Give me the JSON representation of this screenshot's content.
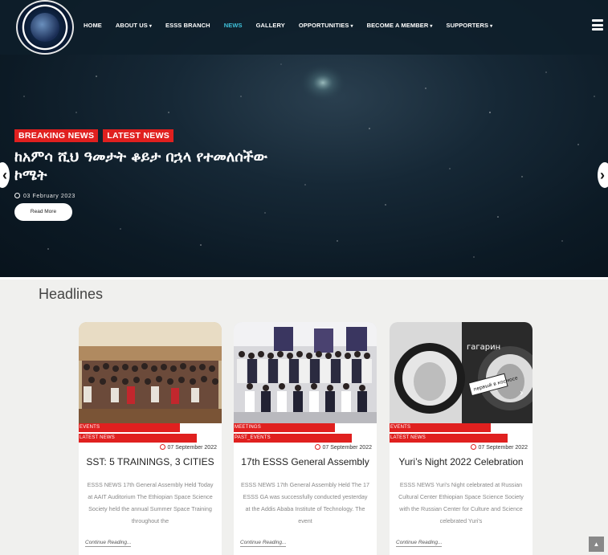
{
  "nav": {
    "items": [
      {
        "label": "HOME",
        "caret": false,
        "active": false
      },
      {
        "label": "ABOUT US",
        "caret": true,
        "active": false
      },
      {
        "label": "ESSS BRANCH",
        "caret": false,
        "active": false
      },
      {
        "label": "NEWS",
        "caret": false,
        "active": true
      },
      {
        "label": "GALLERY",
        "caret": false,
        "active": false
      },
      {
        "label": "OPPORTUNITIES",
        "caret": true,
        "active": false
      },
      {
        "label": "BECOME A MEMBER",
        "caret": true,
        "active": false
      },
      {
        "label": "SUPPORTERS",
        "caret": true,
        "active": false
      }
    ],
    "active_color": "#3fc0d9"
  },
  "hero": {
    "tags": [
      "BREAKING NEWS",
      "LATEST NEWS"
    ],
    "title": "ከአምሳ ሺህ ዓመታት ቆይታ በኋላ የተመለሰችው ኮሜት",
    "date": "03 February 2023",
    "read_more": "Read More"
  },
  "headlines": {
    "title": "Headlines",
    "cards": [
      {
        "labels": [
          "EVENTS",
          "LATEST NEWS"
        ],
        "date": "07 September 2022",
        "title": "SST: 5 TRAININGS, 3 CITIES",
        "excerpt": "ESSS NEWS 17th General Assembly Held Today at AAIT Auditorium The Ethiopian Space Science Society held the annual Summer Space Training throughout the",
        "continue": "Continue Reading..."
      },
      {
        "labels": [
          "MEETINGS",
          "PAST_EVENTS"
        ],
        "date": "07 September 2022",
        "title": "17th ESSS General Assembly",
        "excerpt": "ESSS NEWS 17th General Assembly Held The 17 ESSS GA was successfully conducted yesterday at the Addis Ababa Institute of Technology. The event",
        "continue": "Continue Reading..."
      },
      {
        "labels": [
          "EVENTS",
          "LATEST NEWS"
        ],
        "date": "07 September 2022",
        "title": "Yuri’s Night 2022 Celebration",
        "excerpt": "ESSS NEWS Yuri's Night celebrated at Russian Cultural Center Ethiopian Space Science Society with the Russian Center for Culture and Science celebrated Yuri's",
        "continue": "Continue Reading...",
        "image_text": [
          "гагарин",
          "первый в космосе"
        ]
      }
    ]
  },
  "colors": {
    "accent_red": "#e0201f",
    "hero_bg": "#0c1a25"
  }
}
